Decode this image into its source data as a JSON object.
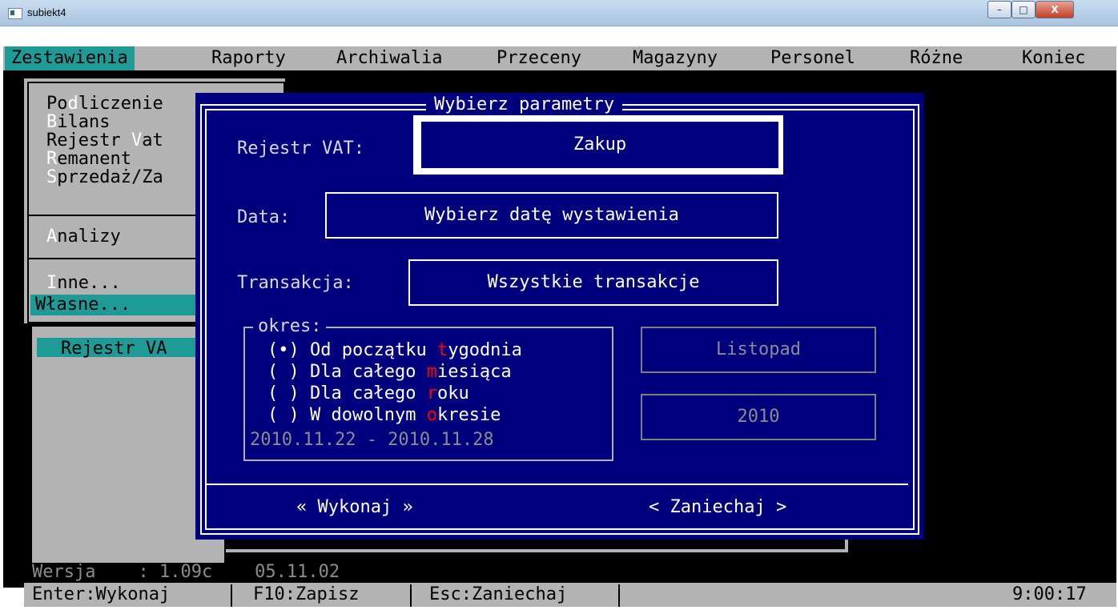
{
  "window": {
    "title": "subiekt4",
    "min_label": "–",
    "max_label": "□",
    "close_label": "X"
  },
  "menu": [
    {
      "label": "Zestawienia",
      "active": true
    },
    {
      "label": "Raporty"
    },
    {
      "label": "Archiwalia"
    },
    {
      "label": "Przeceny"
    },
    {
      "label": "Magazyny"
    },
    {
      "label": "Personel"
    },
    {
      "label": "Różne"
    },
    {
      "label": "Koniec"
    }
  ],
  "dropdown": {
    "items": [
      {
        "pre": "Po",
        "hot": "d",
        "post": "liczenie"
      },
      {
        "pre": "",
        "hot": "B",
        "post": "ilans"
      },
      {
        "pre": "Rejestr ",
        "hot": "V",
        "post": "at"
      },
      {
        "pre": "",
        "hot": "R",
        "post": "emanent"
      },
      {
        "pre": "",
        "hot": "S",
        "post": "przedaż/Za"
      },
      {
        "pre": "",
        "hot": "A",
        "post": "nalizy"
      },
      {
        "pre": "",
        "hot": "I",
        "post": "nne..."
      },
      {
        "pre": "Własne...",
        "hot": "",
        "post": ""
      }
    ],
    "submenu_item": "Rejestr VA"
  },
  "dialog": {
    "title": "Wybierz parametry",
    "vat_label": "Rejestr VAT:",
    "vat_value": "Zakup",
    "date_label": "Data:",
    "date_value": "Wybierz datę wystawienia",
    "trans_label": "Transakcja:",
    "trans_value": "Wszystkie transakcje",
    "okres_label": "okres:",
    "options": [
      {
        "mark": "(•)",
        "pre": "Od początku ",
        "hot": "t",
        "post": "ygodnia",
        "selected": true
      },
      {
        "mark": "( )",
        "pre": "Dla całego ",
        "hot": "m",
        "post": "iesiąca"
      },
      {
        "mark": "( )",
        "pre": "Dla całego ",
        "hot": "r",
        "post": "oku"
      },
      {
        "mark": "( )",
        "pre": "W dowolnym ",
        "hot": "o",
        "post": "kresie"
      }
    ],
    "date_range": "2010.11.22 - 2010.11.28",
    "month": "Listopad",
    "year": "2010",
    "execute": "« Wykonaj »",
    "cancel": "< Zaniechaj >"
  },
  "version": {
    "label": "Wersja",
    "value": ": 1.09c",
    "date": "05.11.02"
  },
  "statusbar": {
    "enter": "Enter:Wykonaj",
    "f10": "F10:Zapisz",
    "esc": "Esc:Zaniechaj",
    "clock": "9:00:17"
  },
  "colors": {
    "dialog_bg": "#00007f",
    "highlight": "#1e9b96",
    "hotkey_red": "#ff0000",
    "gray": "#b3b3b3"
  }
}
